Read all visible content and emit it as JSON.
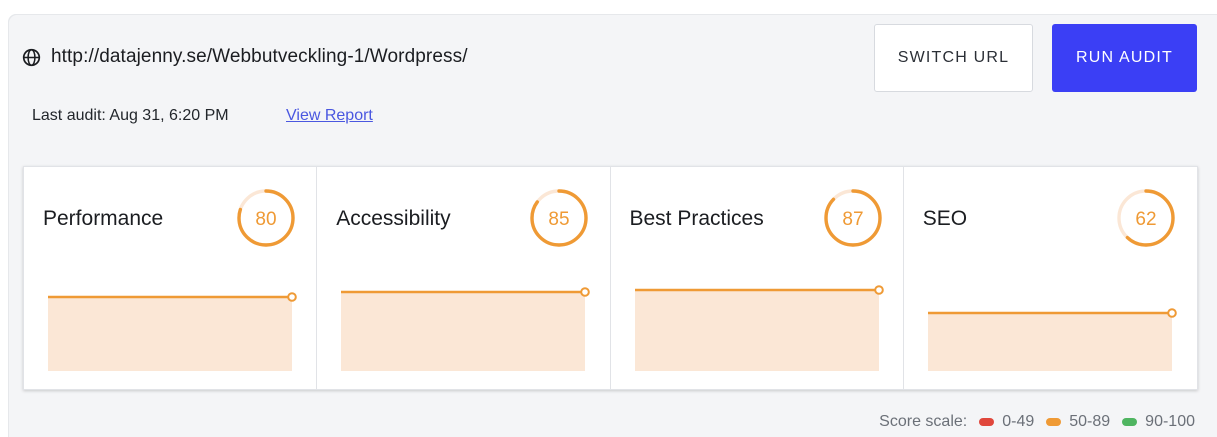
{
  "header": {
    "url": "http://datajenny.se/Webbutveckling-1/Wordpress/",
    "switch_label": "SWITCH URL",
    "run_label": "RUN AUDIT",
    "last_audit": "Last audit: Aug 31, 6:20 PM",
    "view_report": "View Report"
  },
  "colors": {
    "accent": "#3b3ff5",
    "score_orange": "#ef9a35",
    "area_fill": "#fbe7d6",
    "red": "#e0473c",
    "orange": "#ef9a35",
    "green": "#4fb561"
  },
  "cards": [
    {
      "title": "Performance",
      "score": "80"
    },
    {
      "title": "Accessibility",
      "score": "85"
    },
    {
      "title": "Best Practices",
      "score": "87"
    },
    {
      "title": "SEO",
      "score": "62"
    }
  ],
  "legend": {
    "label": "Score scale:",
    "items": [
      {
        "range": "0-49",
        "color": "#e0473c"
      },
      {
        "range": "50-89",
        "color": "#ef9a35"
      },
      {
        "range": "90-100",
        "color": "#4fb561"
      }
    ]
  }
}
